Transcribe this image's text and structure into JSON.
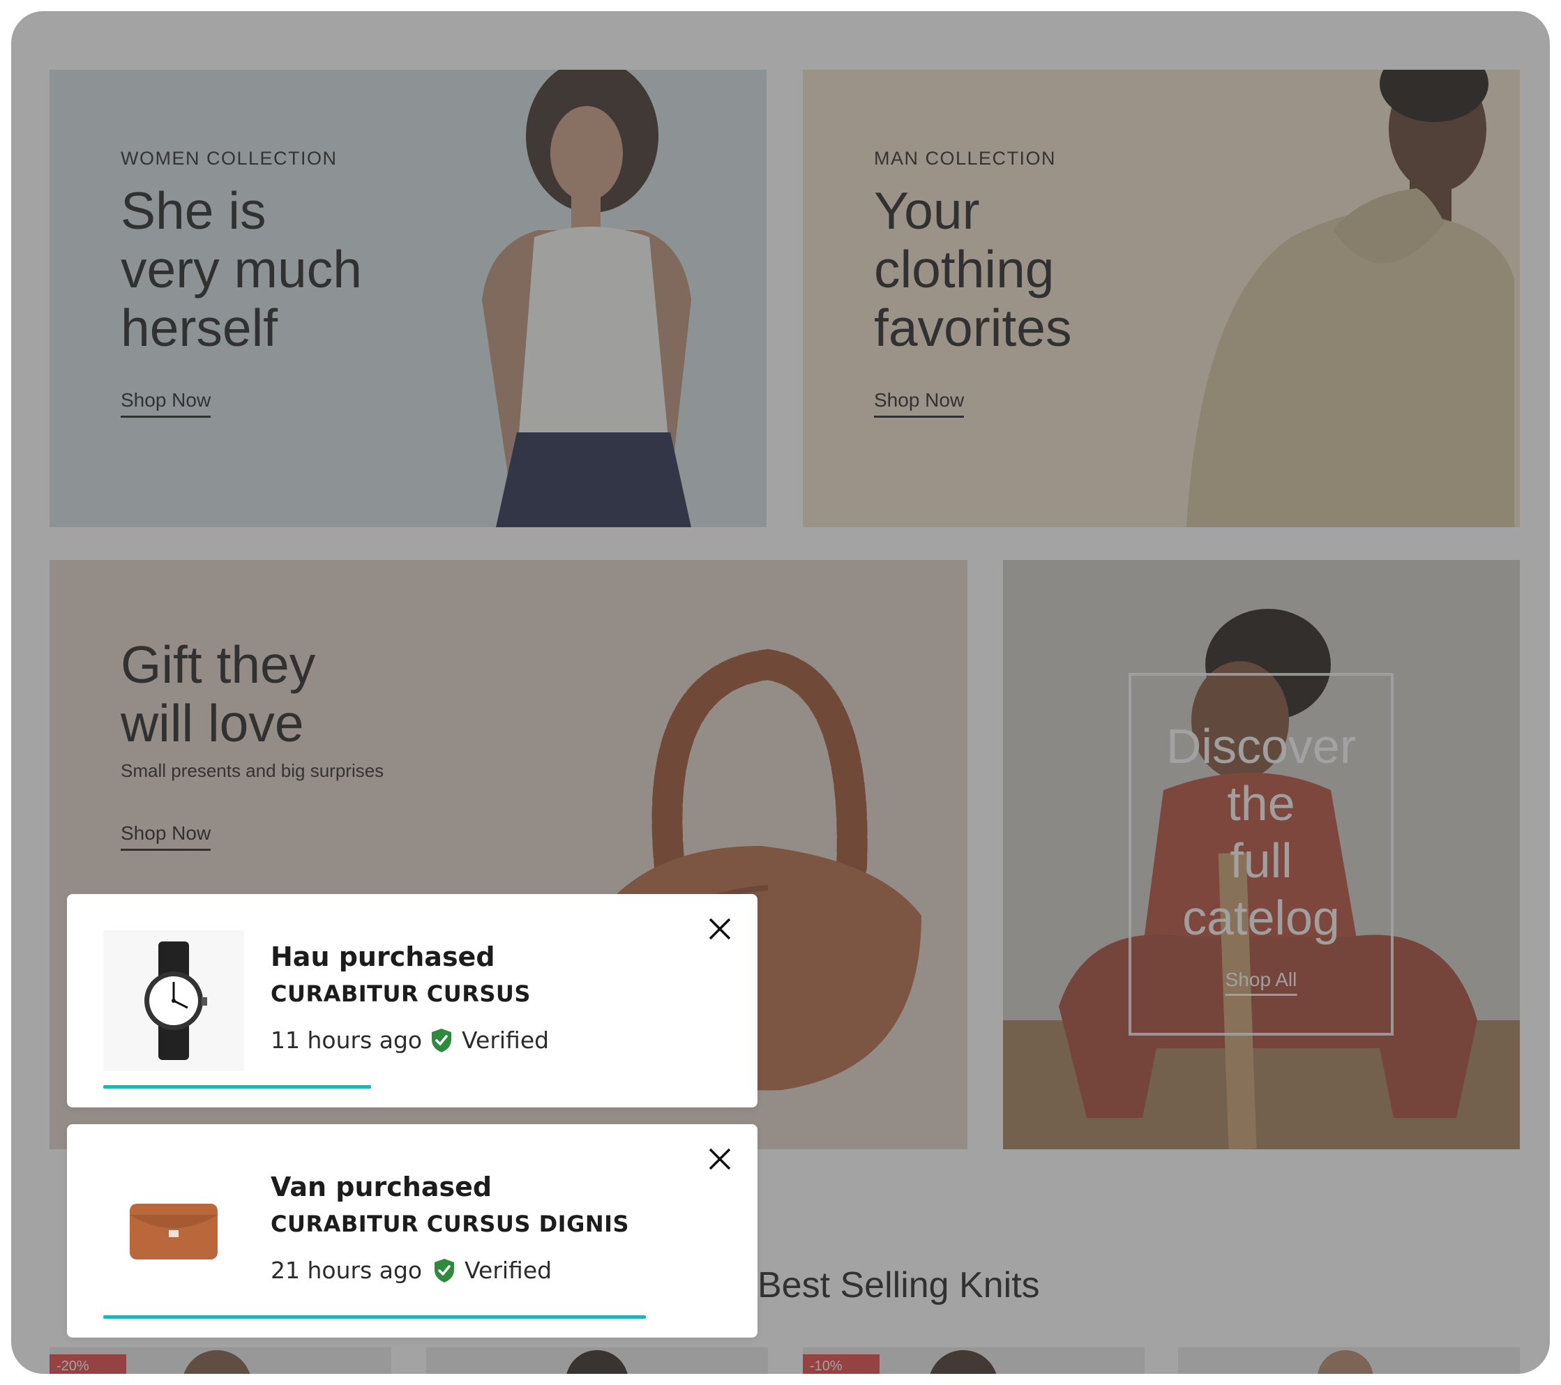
{
  "banners": {
    "women": {
      "eyebrow": "WOMEN COLLECTION",
      "headline": [
        "She is",
        "very much",
        "herself"
      ],
      "cta": "Shop Now"
    },
    "man": {
      "eyebrow": "MAN COLLECTION",
      "headline": [
        "Your",
        "clothing",
        "favorites"
      ],
      "cta": "Shop Now"
    },
    "gift": {
      "headline": [
        "Gift they",
        "will love"
      ],
      "subtitle": "Small presents and big surprises",
      "cta": "Shop Now"
    },
    "catalog": {
      "headline": [
        "Discover",
        "the",
        "full",
        "catelog"
      ],
      "cta": "Shop All"
    }
  },
  "section": {
    "title": "Best Selling Knits"
  },
  "products": {
    "badges": [
      "-20%",
      "-10%"
    ]
  },
  "notifications": [
    {
      "buyer": "Hau purchased",
      "product": "CURABITUR CURSUS",
      "time": "11 hours ago",
      "verified": "Verified",
      "progress": 0.39,
      "icon": "watch-icon"
    },
    {
      "buyer": "Van purchased",
      "product": "CURABITUR CURSUS DIGNIS",
      "time": "21 hours ago",
      "verified": "Verified",
      "progress": 0.79,
      "icon": "wallet-icon"
    }
  ],
  "colors": {
    "accent": "#23b5b5",
    "verified": "#2e8b3e",
    "sale": "#e43c3c"
  }
}
